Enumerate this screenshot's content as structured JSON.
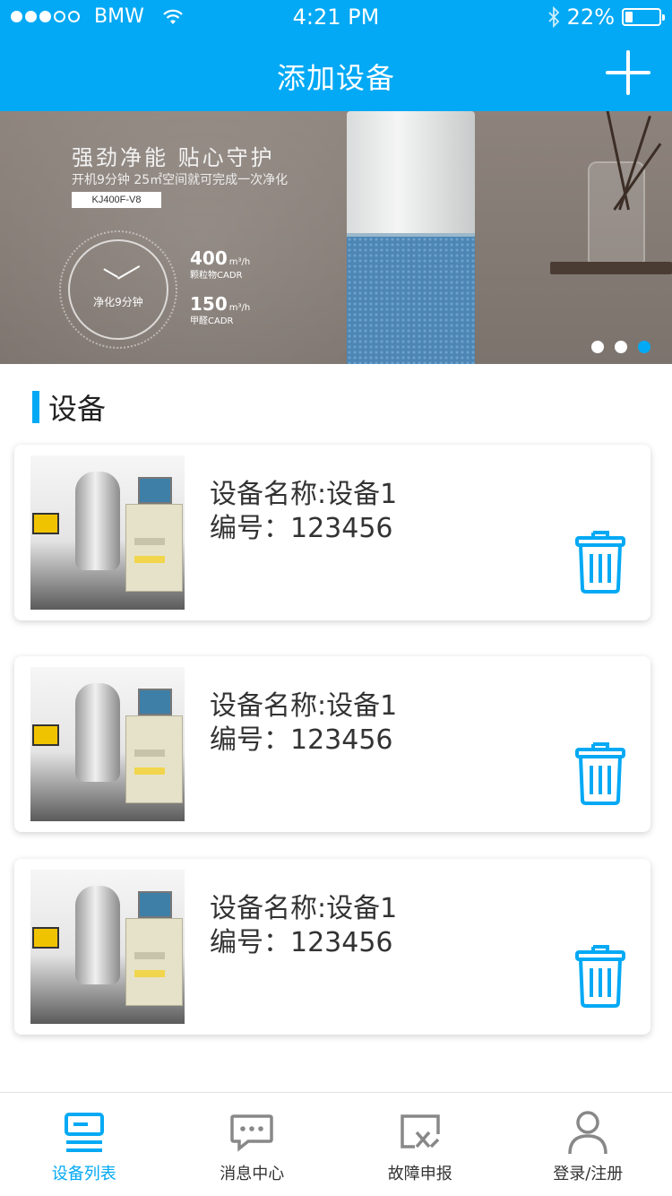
{
  "status_bar": {
    "carrier": "BMW",
    "time": "4:21 PM",
    "battery": "22%"
  },
  "nav": {
    "title": "添加设备",
    "add_icon": "plus-icon"
  },
  "banner": {
    "headline": "强劲净能 贴心守护",
    "subtitle": "开机9分钟 25㎡空间就可完成一次净化",
    "model": "KJ400F-V8",
    "clock_text": "净化9分钟",
    "stat1_value": "400",
    "stat1_unit": "m³/h",
    "stat1_label": "颗粒物CADR",
    "stat2_value": "150",
    "stat2_unit": "m³/h",
    "stat2_label": "甲醛CADR",
    "active_indicator": 3
  },
  "section": {
    "title": "设备"
  },
  "devices": [
    {
      "name": "设备名称:设备1",
      "id": "编号：123456"
    },
    {
      "name": "设备名称:设备1",
      "id": "编号：123456"
    },
    {
      "name": "设备名称:设备1",
      "id": "编号：123456"
    }
  ],
  "tabs": [
    {
      "label": "设备列表",
      "icon": "device-list-icon",
      "active": true
    },
    {
      "label": "消息中心",
      "icon": "message-icon",
      "active": false
    },
    {
      "label": "故障申报",
      "icon": "fault-report-icon",
      "active": false
    },
    {
      "label": "登录/注册",
      "icon": "user-icon",
      "active": false
    }
  ],
  "colors": {
    "accent": "#03a9f4",
    "text": "#333333",
    "inactive_icon": "#888888"
  }
}
